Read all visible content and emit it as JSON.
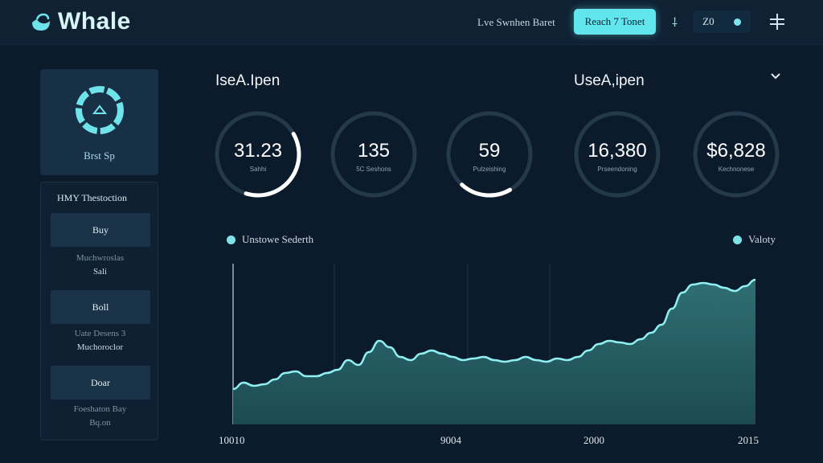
{
  "header": {
    "logo_text": "Whale",
    "link_label": "Lve Swnhen Baret",
    "cta_label": "Reach 7 Tonet",
    "pill_value": "Z0",
    "icons": [
      "plus-icon",
      "crosshair-icon"
    ]
  },
  "sidebar": {
    "profile_label": "Brst Sp",
    "tx_title": "HMY Thestoction",
    "items": [
      {
        "label": "Buy",
        "sub1": "Muchwroslas",
        "sub2": "Sali"
      },
      {
        "label": "Boll",
        "sub1": "Uate Desens 3",
        "sub2": "Muchoroclor"
      },
      {
        "label": "Doar",
        "sub1": "Foeshaton Bay",
        "sub2": "Bq.on"
      }
    ]
  },
  "main": {
    "left_title": "IseA.Ipen",
    "right_title": "UseA,ipen",
    "stats": [
      {
        "value": "31.23",
        "label": "Sahhi",
        "progress": 0.38
      },
      {
        "value": "135",
        "label": "5C Seshons",
        "progress": 0
      },
      {
        "value": "59",
        "label": "Pulzeishing",
        "progress": 0.2
      },
      {
        "value": "16,380",
        "label": "Prseendoning",
        "progress": 0
      },
      {
        "value": "$6,828",
        "label": "Kechnonese",
        "progress": 0
      }
    ],
    "accent": "#62e6ee"
  },
  "chart_data": {
    "type": "area",
    "legend": [
      {
        "name": "Unstowe Sederth",
        "placement": "top-left"
      },
      {
        "name": "Valoty",
        "placement": "top-right"
      }
    ],
    "x_ticks": [
      "10010",
      "9004",
      "2000",
      "2015"
    ],
    "ylim": [
      0,
      100
    ],
    "grid": "vertical",
    "series": [
      {
        "name": "Unstowe Sederth",
        "values": [
          22,
          26,
          24,
          25,
          28,
          32,
          33,
          30,
          30,
          32,
          34,
          40,
          37,
          45,
          52,
          48,
          42,
          40,
          44,
          46,
          44,
          42,
          40,
          41,
          42,
          40,
          39,
          40,
          42,
          40,
          39,
          41,
          40,
          42,
          46,
          50,
          52,
          51,
          50,
          53,
          57,
          62,
          72,
          82,
          87,
          88,
          87,
          85,
          83,
          86,
          90
        ]
      }
    ]
  }
}
